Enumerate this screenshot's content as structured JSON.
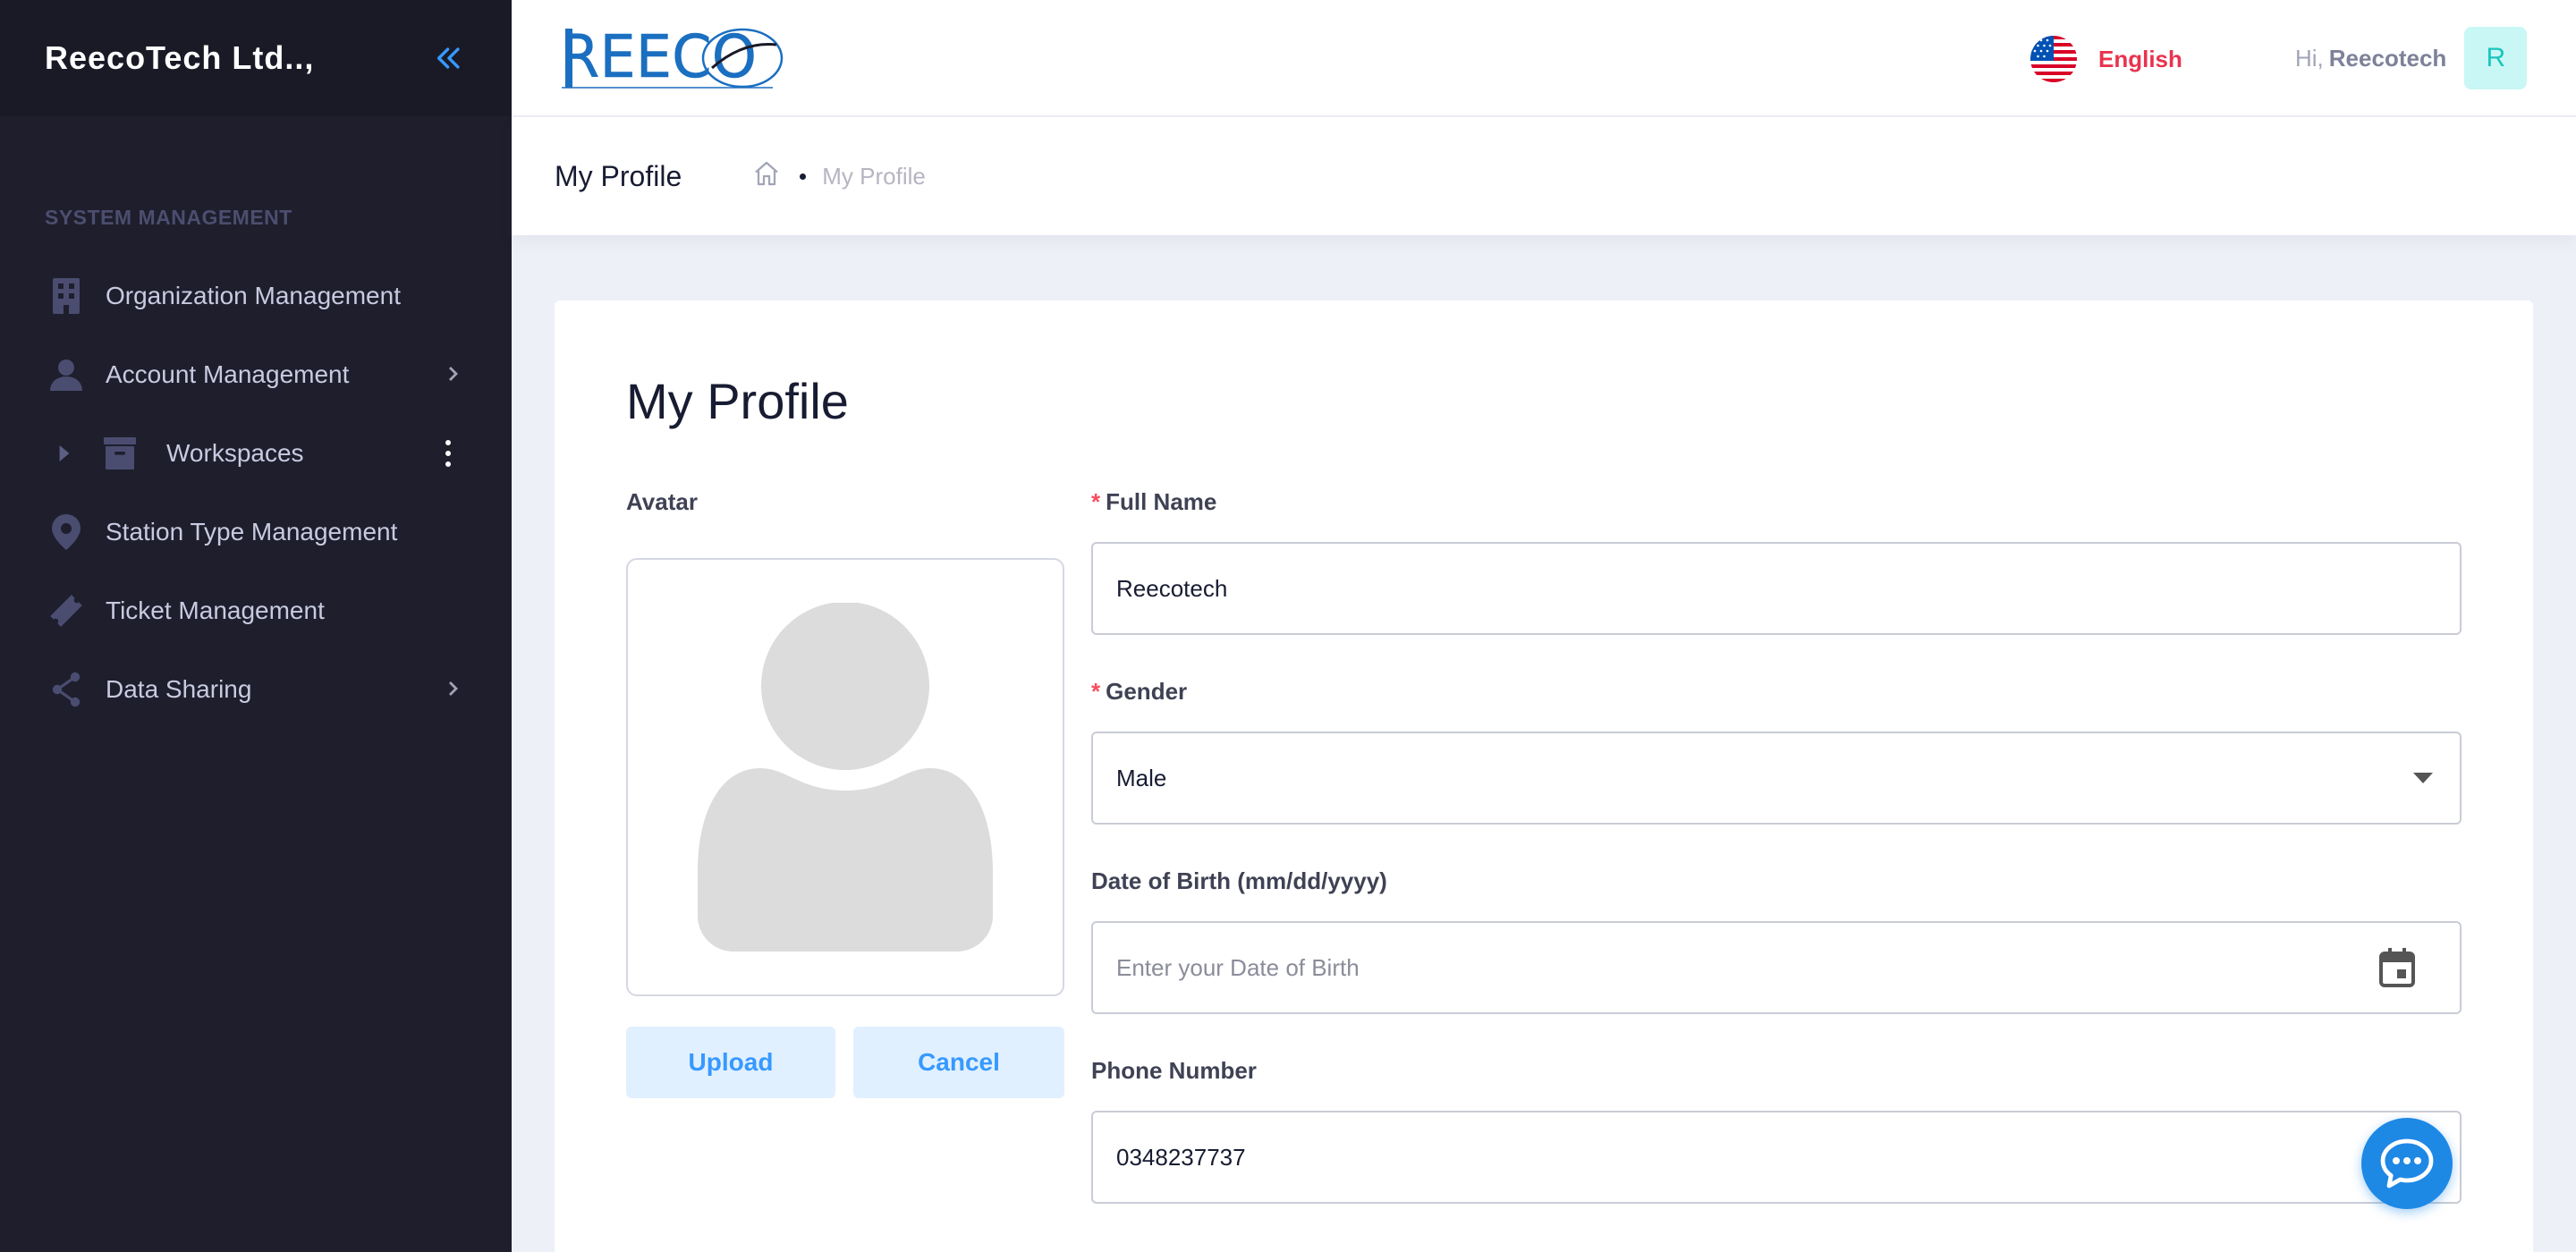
{
  "sidebar": {
    "brand": "ReecoTech Ltd..,",
    "section_title": "SYSTEM MANAGEMENT",
    "items": [
      {
        "label": "Organization Management",
        "icon": "building-icon"
      },
      {
        "label": "Account Management",
        "icon": "user-icon"
      },
      {
        "label": "Workspaces",
        "icon": "archive-box-icon"
      },
      {
        "label": "Station Type Management",
        "icon": "location-pin-icon"
      },
      {
        "label": "Ticket Management",
        "icon": "ticket-icon"
      },
      {
        "label": "Data Sharing",
        "icon": "share-icon"
      }
    ]
  },
  "header": {
    "logo_text": "REECO",
    "language": "English",
    "greeting": "Hi,",
    "username": "Reecotech",
    "avatar_initial": "R"
  },
  "subheader": {
    "title": "My Profile",
    "breadcrumb_current": "My Profile"
  },
  "profile": {
    "title": "My Profile",
    "avatar_label": "Avatar",
    "upload_label": "Upload",
    "cancel_label": "Cancel",
    "full_name_label": "Full Name",
    "full_name_value": "Reecotech",
    "gender_label": "Gender",
    "gender_value": "Male",
    "dob_label": "Date of Birth (mm/dd/yyyy)",
    "dob_placeholder": "Enter your Date of Birth",
    "phone_label": "Phone Number",
    "phone_value": "0348237737",
    "required_mark": "*"
  },
  "colors": {
    "sidebar_bg": "#1e1e2d",
    "accent": "#3699ff",
    "language": "#e8334e",
    "required": "#f64e60",
    "chat": "#1e88e5"
  }
}
